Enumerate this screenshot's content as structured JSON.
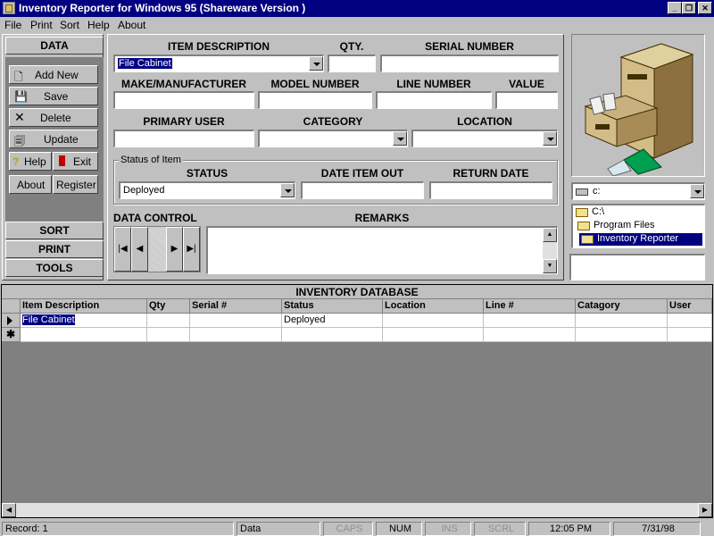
{
  "window": {
    "title": "Inventory Reporter for Windows 95 (Shareware Version )"
  },
  "menu": [
    "File",
    "Print",
    "Sort",
    "Help",
    "About"
  ],
  "left": {
    "data_label": "DATA",
    "add": "Add New",
    "save": "Save",
    "delete": "Delete",
    "update": "Update",
    "help": "Help",
    "exit": "Exit",
    "about": "About",
    "register": "Register",
    "sort": "SORT",
    "print": "PRINT",
    "tools": "TOOLS"
  },
  "form": {
    "item_desc_label": "ITEM DESCRIPTION",
    "item_desc_value": "File Cabinet",
    "qty_label": "QTY.",
    "serial_label": "SERIAL NUMBER",
    "make_label": "MAKE/MANUFACTURER",
    "model_label": "MODEL NUMBER",
    "line_label": "LINE NUMBER",
    "value_label": "VALUE",
    "user_label": "PRIMARY USER",
    "category_label": "CATEGORY",
    "location_label": "LOCATION",
    "status_group": "Status of Item",
    "status_label": "STATUS",
    "status_value": "Deployed",
    "date_out_label": "DATE ITEM OUT",
    "return_label": "RETURN DATE",
    "data_control_label": "DATA CONTROL",
    "remarks_label": "REMARKS"
  },
  "files": {
    "drive": "c:",
    "folders": [
      "C:\\",
      "Program Files",
      "Inventory Reporter"
    ]
  },
  "grid": {
    "title": "INVENTORY DATABASE",
    "columns": [
      "Item Description",
      "Qty",
      "Serial #",
      "Status",
      "Location",
      "Line #",
      "Catagory",
      "User"
    ],
    "rows": [
      [
        "File Cabinet",
        "",
        "",
        "Deployed",
        "",
        "",
        "",
        ""
      ]
    ]
  },
  "statusbar": {
    "record": "Record: 1",
    "mode": "Data",
    "caps": "CAPS",
    "num": "NUM",
    "ins": "INS",
    "scrl": "SCRL",
    "time": "12:05 PM",
    "date": "7/31/98"
  }
}
